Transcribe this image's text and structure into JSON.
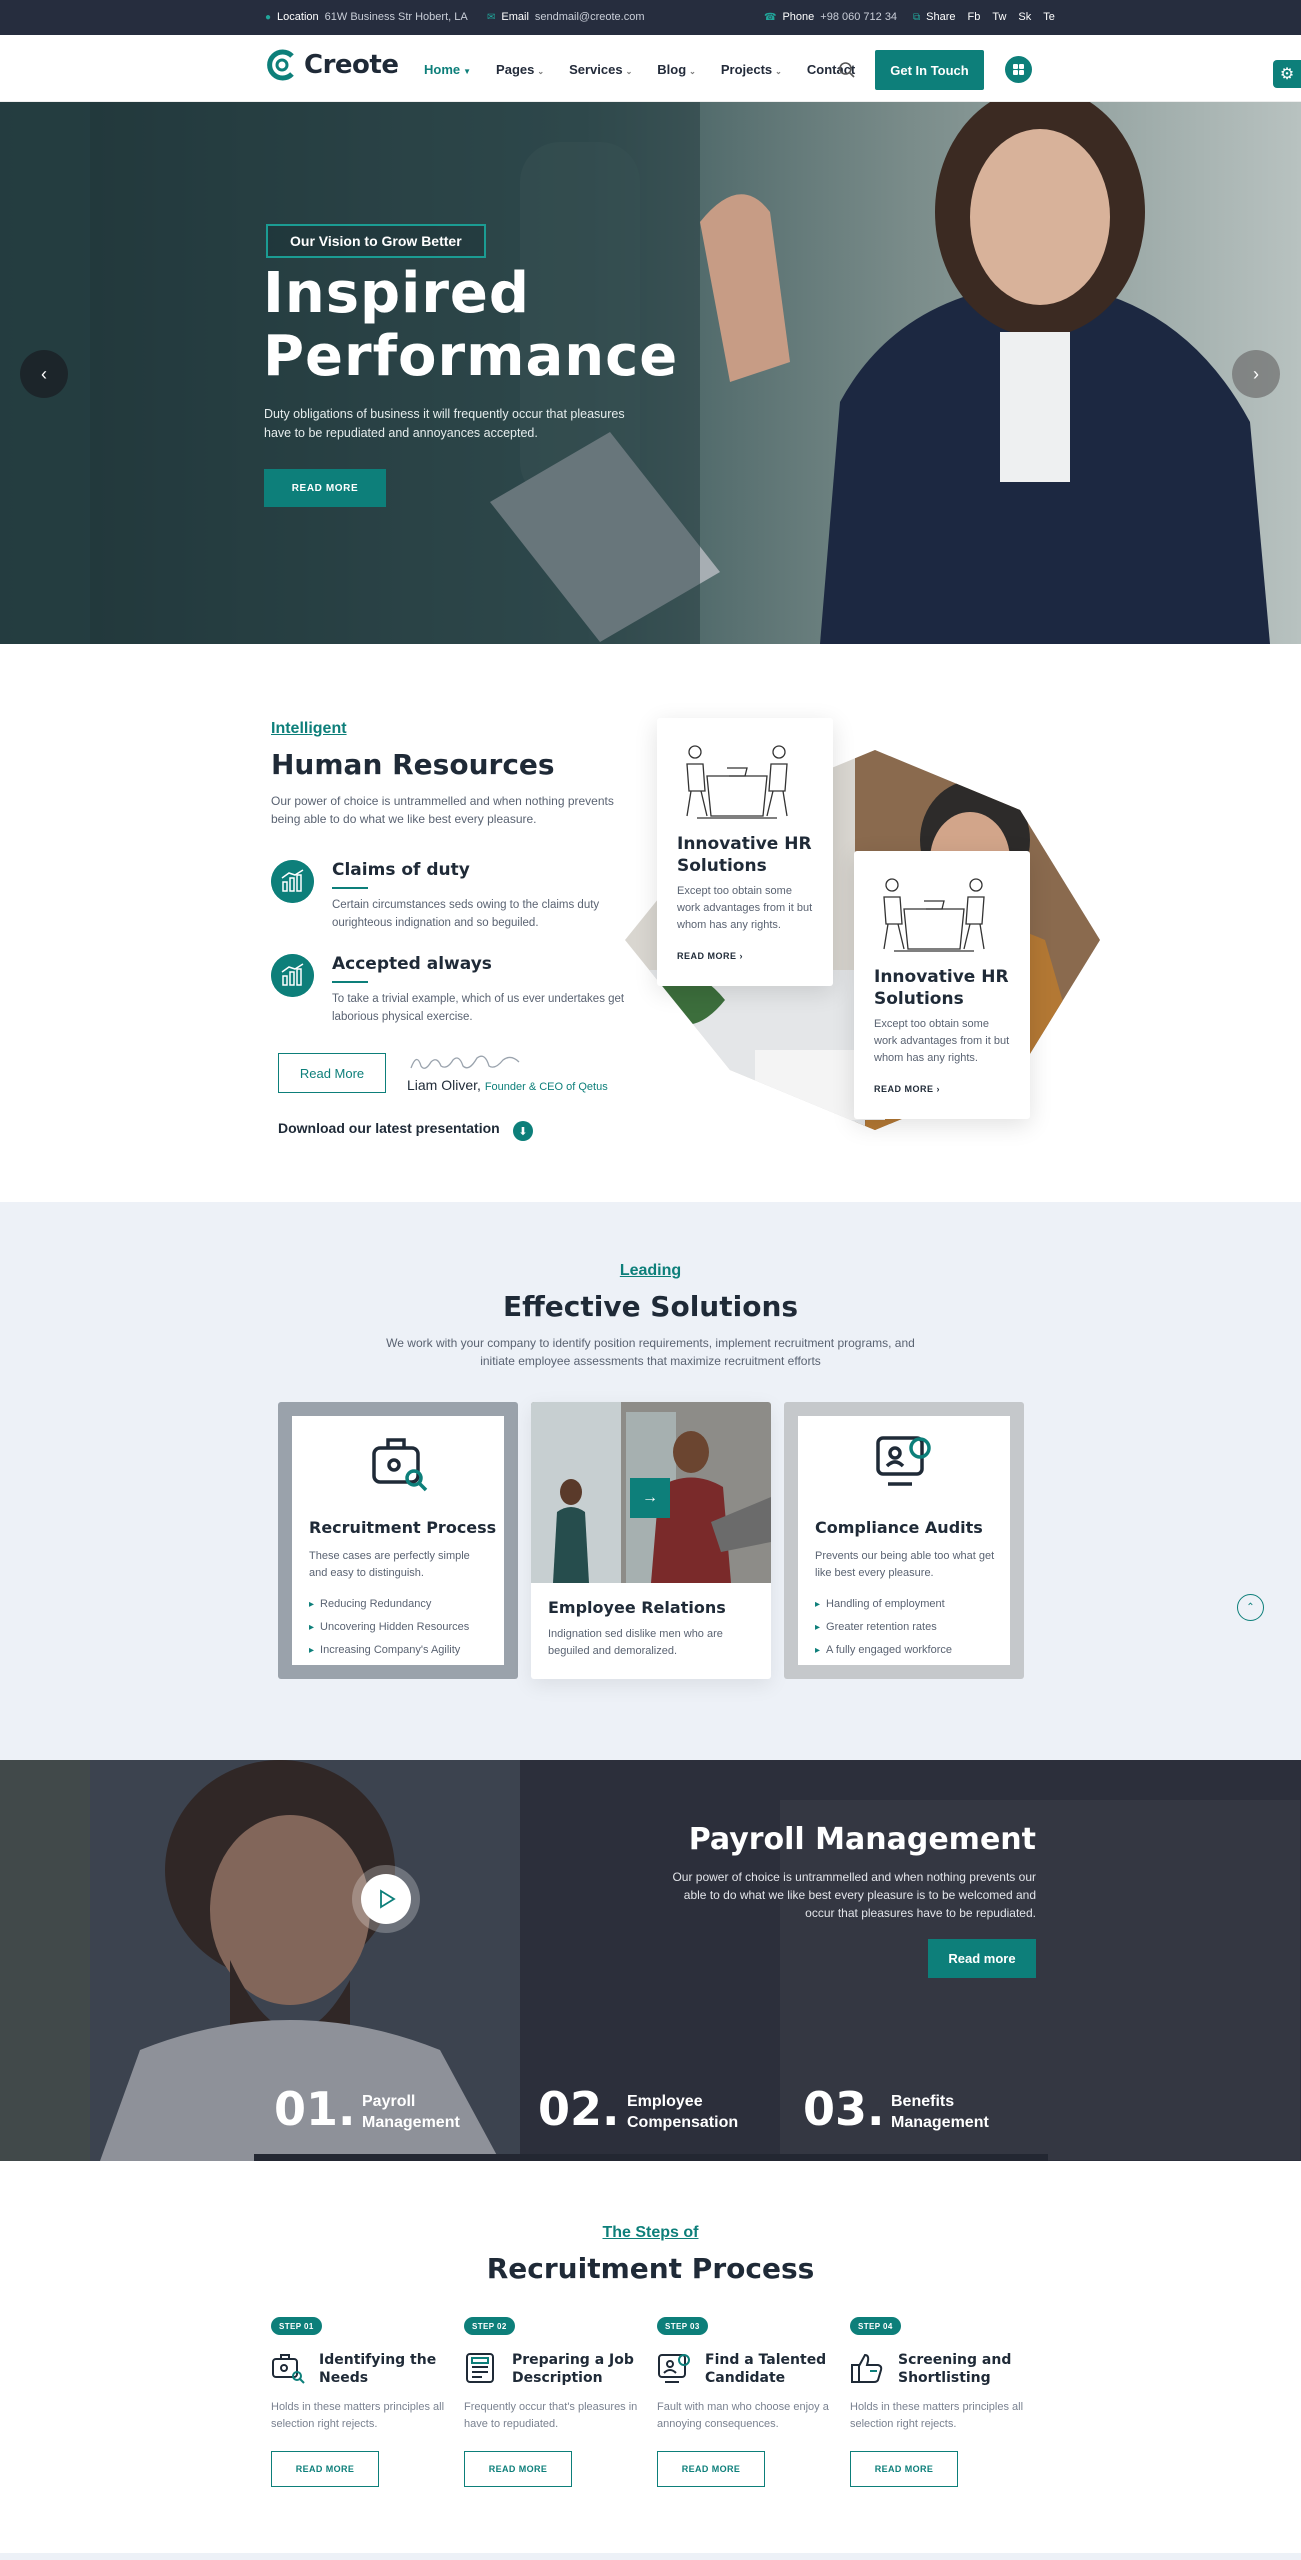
{
  "topbar": {
    "location_label": "Location",
    "location_value": "61W Business Str Hobert, LA",
    "email_label": "Email",
    "email_value": "sendmail@creote.com",
    "phone_label": "Phone",
    "phone_value": "+98 060 712 34",
    "share_label": "Share",
    "social": [
      "Fb",
      "Tw",
      "Sk",
      "Te"
    ]
  },
  "header": {
    "logo_text": "Creote",
    "nav": [
      {
        "label": "Home",
        "active": true,
        "dropdown": true
      },
      {
        "label": "Pages",
        "active": false,
        "dropdown": true
      },
      {
        "label": "Services",
        "active": false,
        "dropdown": true
      },
      {
        "label": "Blog",
        "active": false,
        "dropdown": true
      },
      {
        "label": "Projects",
        "active": false,
        "dropdown": true
      },
      {
        "label": "Contact",
        "active": false,
        "dropdown": false
      }
    ],
    "cta_label": "Get In Touch"
  },
  "hero": {
    "tag": "Our Vision to Grow Better",
    "title_line1": "Inspired",
    "title_line2": "Performance",
    "text": "Duty obligations of business it will frequently occur that pleasures have to be repudiated and annoyances accepted.",
    "button": "READ MORE"
  },
  "hr": {
    "subtitle": "Intelligent",
    "title": "Human Resources",
    "desc": "Our power of choice is untrammelled and when nothing prevents being able to do what we like best every pleasure.",
    "features": [
      {
        "title": "Claims of duty",
        "text": "Certain circumstances seds owing to the claims duty ourighteous indignation and so beguiled."
      },
      {
        "title": "Accepted always",
        "text": "To take a trivial example, which of us ever undertakes get laborious physical exercise."
      }
    ],
    "read_more": "Read More",
    "signature": "Liam Oliver",
    "founder_name": "Liam Oliver,",
    "founder_role": "Founder & CEO of Qetus",
    "download": "Download our latest presentation",
    "cards": [
      {
        "title": "Innovative HR Solutions",
        "text": "Except too obtain some work advantages from it but whom has any rights.",
        "more": "READ MORE"
      },
      {
        "title": "Innovative HR Solutions",
        "text": "Except too obtain some work advantages from it but whom has any rights.",
        "more": "READ MORE"
      }
    ]
  },
  "solutions": {
    "subtitle": "Leading",
    "title": "Effective Solutions",
    "desc_line1": "We work with your company to identify position requirements, implement recruitment programs, and",
    "desc_line2": "initiate employee assessments that maximize recruitment efforts",
    "cards": [
      {
        "title": "Recruitment Process",
        "text": "These cases are perfectly simple and easy to distinguish.",
        "items": [
          "Reducing Redundancy",
          "Uncovering Hidden Resources",
          "Increasing Company's Agility"
        ]
      },
      {
        "title": "Employee Relations",
        "text": "Indignation sed dislike men who are beguiled and demoralized."
      },
      {
        "title": "Compliance Audits",
        "text": "Prevents our being able too what get like best every pleasure.",
        "items": [
          "Handling of employment",
          "Greater retention rates",
          "A fully engaged workforce"
        ]
      }
    ]
  },
  "payroll": {
    "title": "Payroll Management",
    "desc": "Our power of choice is untrammelled and when nothing prevents our able to do what we like best every pleasure is to be welcomed and occur that pleasures have to be repudiated.",
    "button": "Read more",
    "steps": [
      {
        "num": "01.",
        "line1": "Payroll",
        "line2": "Management"
      },
      {
        "num": "02.",
        "line1": "Employee",
        "line2": "Compensation"
      },
      {
        "num": "03.",
        "line1": "Benefits",
        "line2": "Management"
      }
    ]
  },
  "recruitment": {
    "subtitle": "The Steps of",
    "title": "Recruitment Process",
    "steps": [
      {
        "badge": "STEP 01",
        "title": "Identifying the Needs",
        "text": "Holds in these matters principles all selection right rejects.",
        "button": "READ MORE"
      },
      {
        "badge": "STEP 02",
        "title": "Preparing a Job Description",
        "text": "Frequently occur that's pleasures in have to repudiated.",
        "button": "READ MORE"
      },
      {
        "badge": "STEP 03",
        "title": "Find a Talented Candidate",
        "text": "Fault with man who choose enjoy a annoying consequences.",
        "button": "READ MORE"
      },
      {
        "badge": "STEP 04",
        "title": "Screening and Shortlisting",
        "text": "Holds in these matters principles all selection right rejects.",
        "button": "READ MORE"
      }
    ]
  },
  "colors": {
    "accent": "#0d7f7a",
    "dark": "#262d3e",
    "section_bg": "#edf1f7"
  }
}
